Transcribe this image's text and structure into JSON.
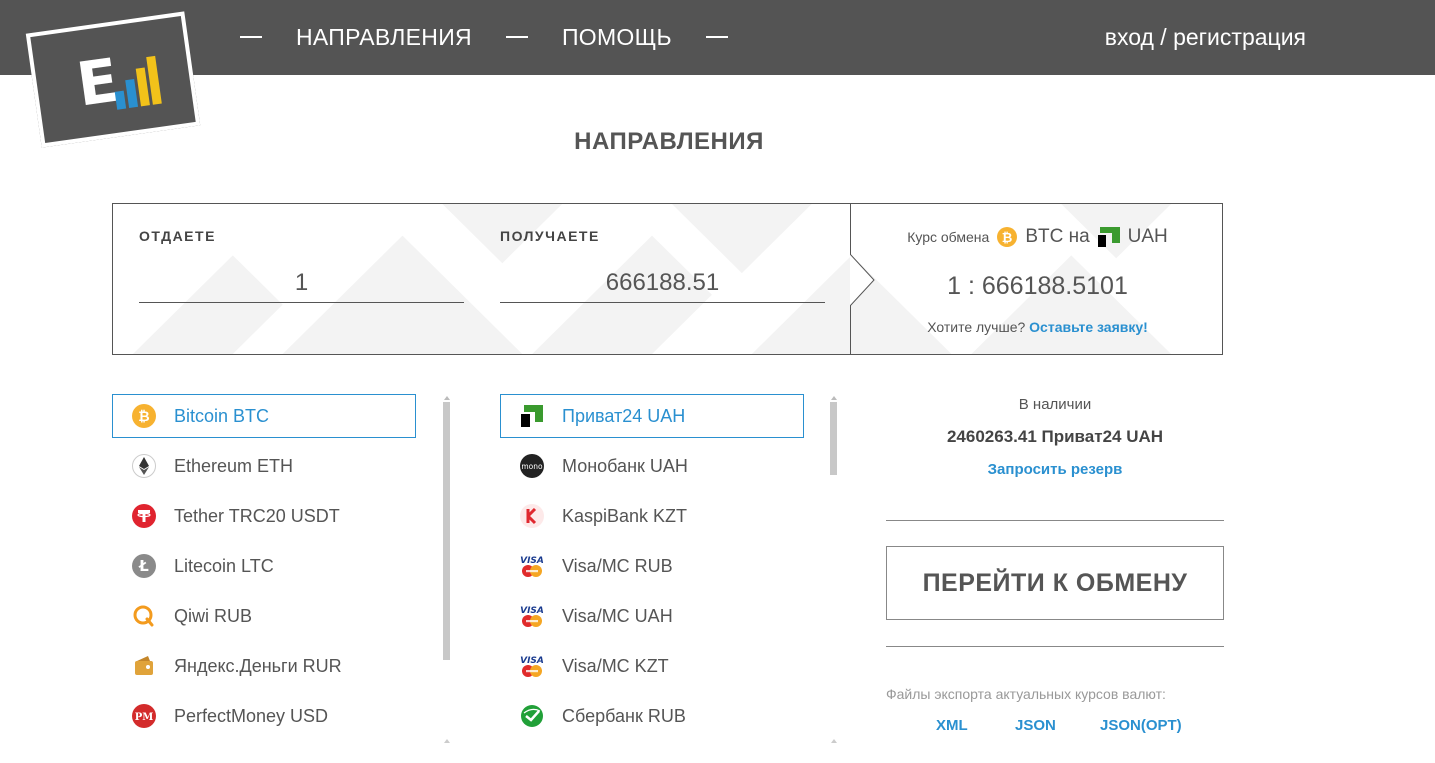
{
  "header": {
    "nav": [
      "НАПРАВЛЕНИЯ",
      "ПОМОЩЬ"
    ],
    "login": "вход / регистрация",
    "logo_icon": "exchange-logo-icon"
  },
  "page": {
    "title": "НАПРАВЛЕНИЯ"
  },
  "calculator": {
    "give_label": "ОТДАЕТЕ",
    "give_value": "1",
    "receive_label": "ПОЛУЧАЕТЕ",
    "receive_value": "666188.51",
    "rate_prefix": "Курс обмена",
    "rate_from": "BTC на",
    "rate_to": "UAH",
    "rate_value": "1 : 666188.5101",
    "better_text": "Хотите лучше?",
    "better_link": "Оставьте заявку!"
  },
  "give_list": [
    {
      "label": "Bitcoin BTC",
      "icon": "bitcoin-icon",
      "active": true
    },
    {
      "label": "Ethereum ETH",
      "icon": "ethereum-icon"
    },
    {
      "label": "Tether TRC20 USDT",
      "icon": "tether-icon"
    },
    {
      "label": "Litecoin LTC",
      "icon": "litecoin-icon"
    },
    {
      "label": "Qiwi RUB",
      "icon": "qiwi-icon"
    },
    {
      "label": "Яндекс.Деньги RUR",
      "icon": "yandex-money-icon"
    },
    {
      "label": "PerfectMoney USD",
      "icon": "perfectmoney-icon"
    }
  ],
  "receive_list": [
    {
      "label": "Приват24 UAH",
      "icon": "privat24-icon",
      "active": true
    },
    {
      "label": "Монобанк UAH",
      "icon": "monobank-icon"
    },
    {
      "label": "KaspiBank KZT",
      "icon": "kaspibank-icon"
    },
    {
      "label": "Visa/MC RUB",
      "icon": "visa-mastercard-icon"
    },
    {
      "label": "Visa/MC UAH",
      "icon": "visa-mastercard-icon"
    },
    {
      "label": "Visa/MC KZT",
      "icon": "visa-mastercard-icon"
    },
    {
      "label": "Сбербанк RUB",
      "icon": "sberbank-icon"
    }
  ],
  "reserve": {
    "label": "В наличии",
    "amount": "2460263.41 Приват24 UAH",
    "request_link": "Запросить резерв"
  },
  "exchange_button": "ПЕРЕЙТИ К ОБМЕНУ",
  "export": {
    "title": "Файлы экспорта актуальных курсов валют:",
    "links": [
      "XML",
      "JSON",
      "JSON(OPT)"
    ]
  },
  "colors": {
    "header_bg": "#545454",
    "accent": "#2a90d0"
  }
}
